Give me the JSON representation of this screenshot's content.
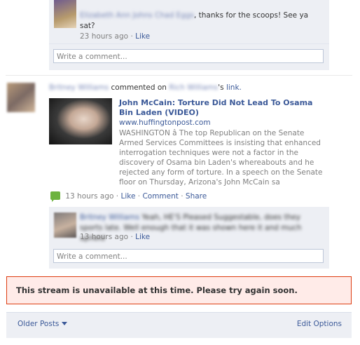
{
  "top_comment": {
    "author": "Elizabeth Ann Johns Chad Eggs",
    "text": ", thanks for the scoops! See ya sat?",
    "time": "23 hours ago",
    "like": "Like"
  },
  "top_write_placeholder": "Write a comment...",
  "post": {
    "author": "Britney Williams",
    "action": "commented on",
    "target": "Rich Williams",
    "possessive": "'s",
    "link_label": "link.",
    "article": {
      "title": "John McCain: Torture Did Not Lead To Osama Bin Laden (VIDEO)",
      "url": "www.huffingtonpost.com",
      "description": "WASHINGTON â The top Republican on the Senate Armed Services Committees is insisting that enhanced interrogation techniques were not a factor in the discovery of Osama bin Laden's whereabouts and he rejected any form of torture. In a speech on the Senate floor on Thursday, Arizona's John McCain sa"
    },
    "time": "13 hours ago",
    "separator": "·",
    "actions": [
      "Like",
      "Comment",
      "Share"
    ]
  },
  "post_comment": {
    "author": "Britney Williams",
    "text": "Yeah, HE'S Pleased Suggestable, does they sports late. Well enough that it was shown here it and much upheld",
    "time": "13 hours ago",
    "like": "Like"
  },
  "post_write_placeholder": "Write a comment...",
  "error_message": "This stream is unavailable at this time. Please try again soon.",
  "footer": {
    "older_posts": "Older Posts",
    "edit_options": "Edit Options"
  }
}
